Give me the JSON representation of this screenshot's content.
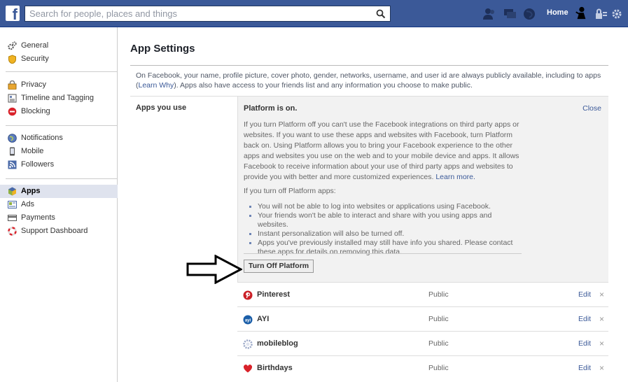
{
  "topbar": {
    "search_placeholder": "Search for people, places and things",
    "home_label": "Home",
    "brand_color": "#3b5998"
  },
  "sidebar": {
    "groups": [
      [
        {
          "label": "General",
          "icon": "gear-icon"
        },
        {
          "label": "Security",
          "icon": "shield-icon"
        }
      ],
      [
        {
          "label": "Privacy",
          "icon": "lock-icon"
        },
        {
          "label": "Timeline and Tagging",
          "icon": "timeline-icon"
        },
        {
          "label": "Blocking",
          "icon": "block-icon"
        }
      ],
      [
        {
          "label": "Notifications",
          "icon": "globe-icon"
        },
        {
          "label": "Mobile",
          "icon": "mobile-icon"
        },
        {
          "label": "Followers",
          "icon": "rss-icon"
        }
      ],
      [
        {
          "label": "Apps",
          "icon": "cube-icon",
          "active": true
        },
        {
          "label": "Ads",
          "icon": "ads-icon"
        },
        {
          "label": "Payments",
          "icon": "card-icon"
        },
        {
          "label": "Support Dashboard",
          "icon": "lifebuoy-icon"
        }
      ]
    ]
  },
  "main": {
    "title": "App Settings",
    "intro_text": "On Facebook, your name, profile picture, cover photo, gender, networks, username, and user id are always publicly available, including to apps (",
    "intro_link": "Learn Why",
    "intro_text_2": "). Apps also have access to your friends list and any information you choose to make public.",
    "section_label": "Apps you use",
    "platform": {
      "heading": "Platform is on.",
      "close_label": "Close",
      "description": "If you turn Platform off you can't use the Facebook integrations on third party apps or websites. If you want to use these apps and websites with Facebook, turn Platform back on. Using Platform allows you to bring your Facebook experience to the other apps and websites you use on the web and to your mobile device and apps. It allows Facebook to receive information about your use of third party apps and websites to provide you with better and more customized experiences.",
      "learn_more": "Learn more.",
      "off_heading": "If you turn off Platform apps:",
      "bullets": [
        "You will not be able to log into websites or applications using Facebook.",
        "Your friends won't be able to interact and share with you using apps and websites.",
        "Instant personalization will also be turned off.",
        "Apps you've previously installed may still have info you shared. Please contact these apps for details on removing this data."
      ],
      "button_label": "Turn Off Platform"
    },
    "apps": [
      {
        "name": "Pinterest",
        "visibility": "Public",
        "edit": "Edit",
        "icon": "pinterest-icon",
        "color": "#cb2027"
      },
      {
        "name": "AYI",
        "visibility": "Public",
        "edit": "Edit",
        "icon": "ayi-icon",
        "color": "#1a5ea8"
      },
      {
        "name": "mobileblog",
        "visibility": "Public",
        "edit": "Edit",
        "icon": "mobileblog-icon",
        "color": "#9aa7c7"
      },
      {
        "name": "Birthdays",
        "visibility": "Public",
        "edit": "Edit",
        "icon": "heart-icon",
        "color": "#d9222a"
      }
    ],
    "delete_glyph": "×"
  }
}
